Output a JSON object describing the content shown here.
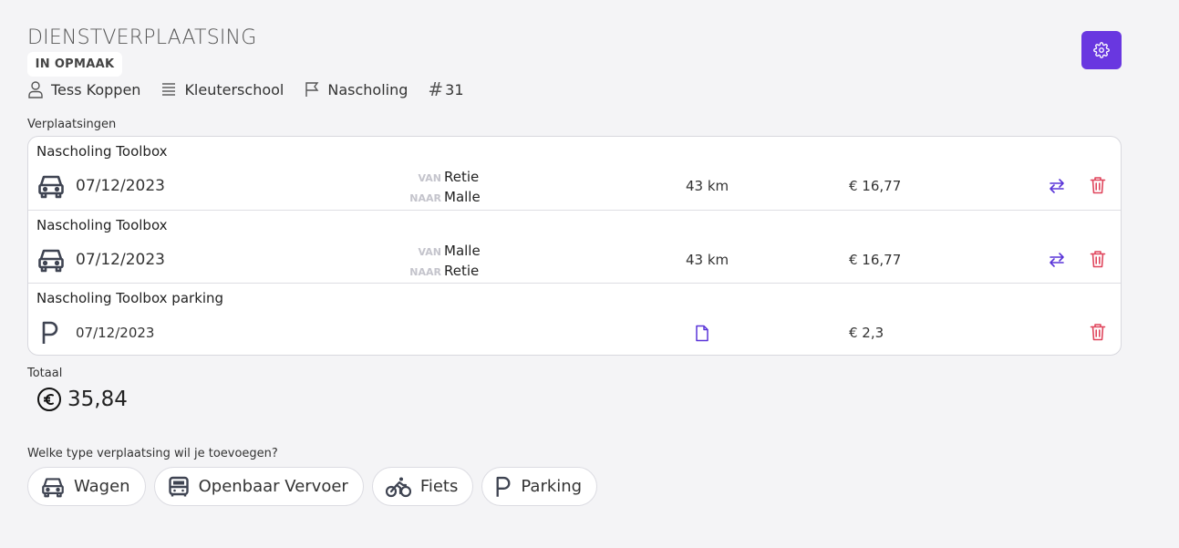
{
  "header": {
    "title": "DIENSTVERPLAATSING",
    "status": "IN OPMAAK",
    "person": "Tess Koppen",
    "school": "Kleuterschool",
    "category": "Nascholing",
    "id_hash": "#",
    "id_number": "31"
  },
  "trips_label": "Verplaatsingen",
  "trips": [
    {
      "title": "Nascholing Toolbox",
      "icon": "car-icon",
      "date": "07/12/2023",
      "from_label": "VAN",
      "from": "Retie",
      "to_label": "NAAR",
      "to": "Malle",
      "distance": "43 km",
      "amount": "€ 16,77"
    },
    {
      "title": "Nascholing Toolbox",
      "icon": "car-icon",
      "date": "07/12/2023",
      "from_label": "VAN",
      "from": "Malle",
      "to_label": "NAAR",
      "to": "Retie",
      "distance": "43 km",
      "amount": "€ 16,77"
    },
    {
      "title": "Nascholing Toolbox parking",
      "icon": "parking-icon",
      "date": "07/12/2023",
      "attachment_icon": "document-icon",
      "amount": "€ 2,3"
    }
  ],
  "total": {
    "label": "Totaal",
    "value": "35,84"
  },
  "add": {
    "prompt": "Welke type verplaatsing wil je toevoegen?",
    "options": [
      "Wagen",
      "Openbaar Vervoer",
      "Fiets",
      "Parking"
    ]
  },
  "colors": {
    "accent": "#6937e0",
    "danger": "#e0455c",
    "background": "#f4f4f6"
  }
}
